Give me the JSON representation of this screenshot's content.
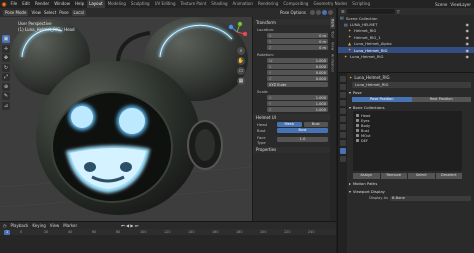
{
  "menu": {
    "items": [
      "File",
      "Edit",
      "Render",
      "Window",
      "Help"
    ],
    "workspace_tabs": [
      "Layout",
      "Modeling",
      "Sculpting",
      "UV Editing",
      "Texture Paint",
      "Shading",
      "Animation",
      "Rendering",
      "Compositing",
      "Geometry Nodes",
      "Scripting"
    ],
    "active_tab": "Layout",
    "scene": "Scene",
    "view_layer": "ViewLayer"
  },
  "viewport_header": {
    "mode": "Pose Mode",
    "view": "View",
    "select": "Select",
    "pose": "Pose",
    "transform_orientation": "Local",
    "pose_options": "Pose Options"
  },
  "viewport": {
    "info_line1": "User Perspective",
    "info_line2": "(1) Luna_Helmet_RIG : Head",
    "colors": {
      "background": "#3d3d3d",
      "glow": "#8ad6ff",
      "helmet": "#2c302c"
    }
  },
  "npanel": {
    "tabs": [
      "Item",
      "Tool",
      "View",
      "Animation"
    ],
    "transform_header": "Transform",
    "location_label": "Location:",
    "location": [
      [
        "X",
        "0 m"
      ],
      [
        "Y",
        "0 m"
      ],
      [
        "Z",
        "0 m"
      ]
    ],
    "rotation_label": "Rotation:",
    "rotation": [
      [
        "W",
        "1.000"
      ],
      [
        "X",
        "0.000"
      ],
      [
        "Y",
        "0.000"
      ],
      [
        "Z",
        "0.000"
      ]
    ],
    "rotation_mode": "XYZ Euler",
    "scale_label": "Scale:",
    "scale": [
      [
        "X",
        "1.000"
      ],
      [
        "Y",
        "1.000"
      ],
      [
        "Z",
        "1.000"
      ]
    ],
    "helmet_header": "Helmet UI",
    "helmet_rows": [
      {
        "label": "Head",
        "options": [
          "Mesh",
          "Bust"
        ],
        "active": 0
      },
      {
        "label": "Bust",
        "options": [
          "Bust"
        ],
        "active": 0
      },
      {
        "label": "Face Type",
        "options": [
          "1.0"
        ],
        "active": -1
      }
    ],
    "properties_header": "Properties"
  },
  "outliner": {
    "search_placeholder": "",
    "rows": [
      {
        "label": "Scene Collection",
        "indent": 0,
        "selected": false
      },
      {
        "label": "LUNA_HELMET",
        "indent": 1,
        "selected": false
      },
      {
        "label": "Helmet_RIG",
        "indent": 2,
        "selected": false
      },
      {
        "label": "Helmet_RIG_1",
        "indent": 2,
        "selected": false
      },
      {
        "label": "Luna_Helmet_Alpha",
        "indent": 2,
        "selected": false
      },
      {
        "label": "Luna_Helmet_RIG",
        "indent": 2,
        "selected": true
      },
      {
        "label": "Luna_Helmet_RIG",
        "indent": 1,
        "selected": false
      }
    ]
  },
  "properties": {
    "object_name": "Luna_Helmet_RIG",
    "pose_header": "Pose",
    "pose_position": [
      "Pose Position",
      "Rest Position"
    ],
    "bone_collections_header": "Bone Collections",
    "bones": [
      "Head",
      "Eyes",
      "Body",
      "Bust",
      "MOut",
      "DEF"
    ],
    "list_buttons": [
      "Assign",
      "Remove",
      "Select",
      "Deselect"
    ],
    "motion_paths": "Motion Paths",
    "viewport_display": "Viewport Display",
    "display_as_label": "Display As",
    "display_as": "B-Bone"
  },
  "timeline": {
    "playback": "Playback",
    "keying": "Keying",
    "view": "View",
    "marker": "Marker",
    "current_frame": "1",
    "ticks": [
      "0",
      "20",
      "40",
      "60",
      "80",
      "100",
      "120",
      "140",
      "160",
      "180",
      "200",
      "220",
      "240"
    ]
  }
}
